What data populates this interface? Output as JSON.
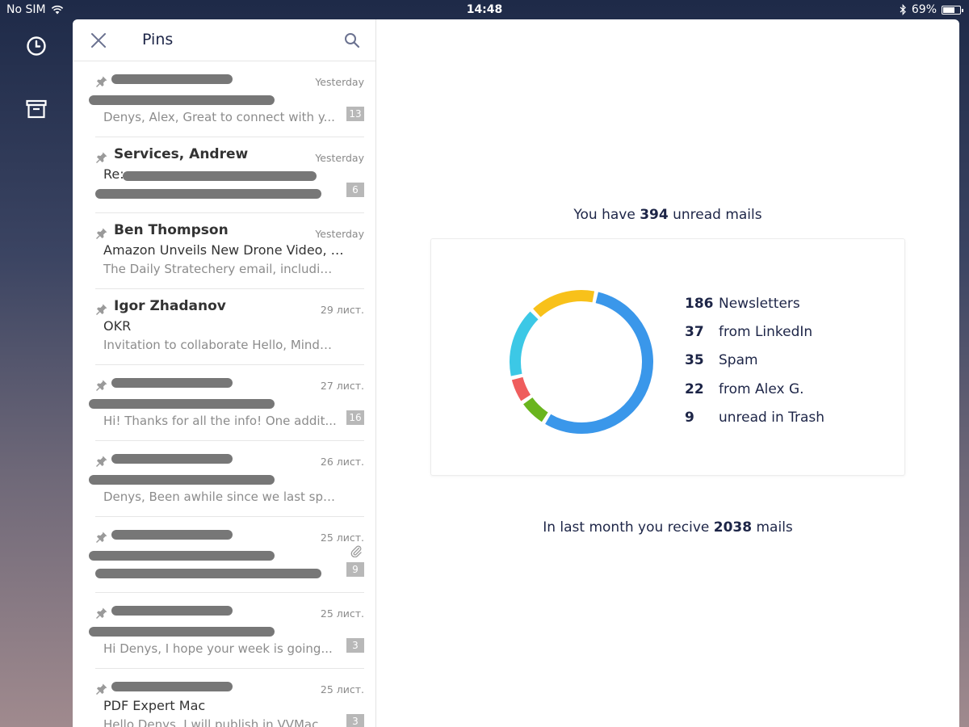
{
  "status_bar": {
    "carrier": "No SIM",
    "time": "14:48",
    "battery": "69%",
    "battery_level": 0.69
  },
  "rail": {
    "icons": [
      "clock-icon",
      "archive-icon"
    ]
  },
  "list": {
    "title": "Pins",
    "items": [
      {
        "sender": "",
        "sender_redacted": true,
        "date": "Yesterday",
        "subject": "",
        "subject_redacted": true,
        "preview": "Denys, Alex, Great to connect with y...",
        "count": "13"
      },
      {
        "sender": "Services, Andrew",
        "date": "Yesterday",
        "subject": "Re:",
        "subject_redacted": true,
        "preview": "",
        "preview_redacted": true,
        "count": "6"
      },
      {
        "sender": "Ben Thompson",
        "date": "Yesterday",
        "subject": "Amazon Unveils New Drone Video, A...",
        "preview": "The Daily Stratechery email, including ex...",
        "count": ""
      },
      {
        "sender": "Igor Zhadanov",
        "date": "29 лист.",
        "subject": "OKR",
        "preview": "Invitation to collaborate Hello, MindMeis...",
        "count": ""
      },
      {
        "sender": "",
        "sender_redacted": true,
        "date": "27 лист.",
        "subject": "",
        "subject_redacted": true,
        "preview": "Hi! Thanks for all the info! One addit...",
        "count": "16"
      },
      {
        "sender": "",
        "sender_redacted": true,
        "date": "26 лист.",
        "subject": "",
        "subject_redacted": true,
        "preview": "Denys, Been awhile since we last spoke!...",
        "count": ""
      },
      {
        "sender": "",
        "sender_redacted": true,
        "date": "25 лист.",
        "subject": "",
        "subject_redacted": true,
        "preview": "",
        "preview_redacted": true,
        "count": "9",
        "attachment": true
      },
      {
        "sender": "",
        "sender_redacted": true,
        "date": "25 лист.",
        "subject": "",
        "subject_redacted": true,
        "preview": "Hi Denys, I hope your week is going...",
        "count": "3"
      },
      {
        "sender": "",
        "sender_redacted": true,
        "date": "25 лист.",
        "subject": "PDF Expert Mac",
        "preview": "Hello Denys, I will publish in VVMac...",
        "count": "3"
      }
    ]
  },
  "stats": {
    "unread_prefix": "You have",
    "unread_count": "394",
    "unread_suffix": "unread mails",
    "month_prefix": "In last month you recive",
    "month_count": "2038",
    "month_suffix": "mails"
  },
  "chart_data": {
    "type": "pie",
    "style": "donut",
    "categories": [
      "Newsletters",
      "from LinkedIn",
      "Spam",
      "from Alex G.",
      "unread in Trash"
    ],
    "values": [
      186,
      37,
      35,
      22,
      9
    ],
    "labels": [
      {
        "value": "186",
        "text": "Newsletters"
      },
      {
        "value": "37",
        "text": "from LinkedIn"
      },
      {
        "value": "35",
        "text": "Spam"
      },
      {
        "value": "22",
        "text": "from Alex G."
      },
      {
        "value": "9",
        "text": "unread in Trash"
      }
    ],
    "arcs": [
      {
        "color": "#3a97ea",
        "value": 186
      },
      {
        "color": "#6ab51e",
        "value": 22
      },
      {
        "color": "#ef5d5d",
        "value": 20
      },
      {
        "color": "#3cc8e6",
        "value": 55
      },
      {
        "color": "#f8c11a",
        "value": 52
      }
    ],
    "legend": "right"
  }
}
